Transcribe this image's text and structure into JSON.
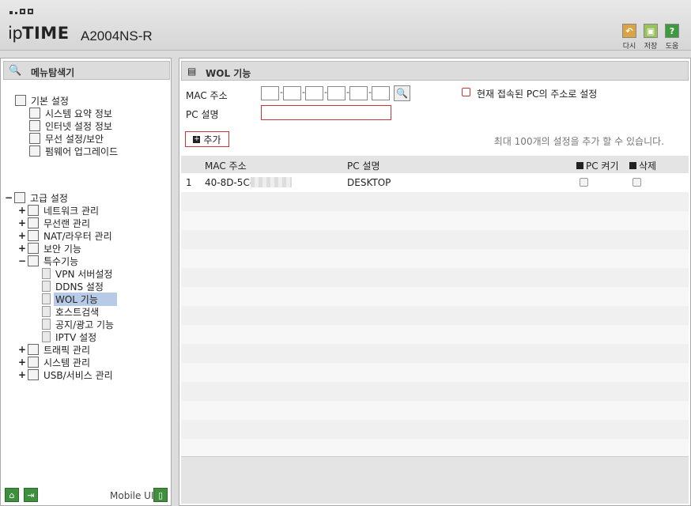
{
  "header": {
    "logo_ip": "ip",
    "logo_time": "TIME",
    "model": "A2004NS-R",
    "buttons": [
      {
        "label": "다시",
        "icon": "undo-icon",
        "color": "#d9a441"
      },
      {
        "label": "저장",
        "icon": "save-icon",
        "color": "#9ac25a"
      },
      {
        "label": "도움",
        "icon": "help-icon",
        "color": "#3f9a3f",
        "glyph": "?"
      }
    ]
  },
  "left": {
    "title": "메뉴탐색기",
    "basic": {
      "label": "기본 설정",
      "items": [
        "시스템 요약 정보",
        "인터넷 설정 정보",
        "무선 설정/보안",
        "펌웨어 업그레이드"
      ]
    },
    "advanced": {
      "label": "고급 설정",
      "items": [
        {
          "label": "네트워크 관리",
          "exp": "+"
        },
        {
          "label": "무선랜 관리",
          "exp": "+"
        },
        {
          "label": "NAT/라우터 관리",
          "exp": "+"
        },
        {
          "label": "보안 기능",
          "exp": "+"
        },
        {
          "label": "특수기능",
          "exp": "−"
        }
      ],
      "special": [
        "VPN 서버설정",
        "DDNS 설정",
        "WOL 기능",
        "호스트검색",
        "공지/광고 기능",
        "IPTV 설정"
      ],
      "more": [
        {
          "label": "트래픽 관리",
          "exp": "+"
        },
        {
          "label": "시스템 관리",
          "exp": "+"
        },
        {
          "label": "USB/서비스 관리",
          "exp": "+"
        }
      ]
    },
    "mobile_label": "Mobile UI"
  },
  "right": {
    "title": "WOL 기능",
    "mac_label": "MAC 주소",
    "pc_label": "PC 설명",
    "current_pc_label": "현재 접속된 PC의 주소로 설정",
    "add_label": "추가",
    "limit_text": "최대 100개의 설정을 추가 할 수 있습니다.",
    "table": {
      "headers": {
        "mac": "MAC 주소",
        "pc": "PC 설명",
        "power": "PC 켜기",
        "delete": "삭제"
      },
      "rows": [
        {
          "num": "1",
          "mac": "40-8D-5C-",
          "pc": "DESKTOP"
        }
      ]
    }
  }
}
